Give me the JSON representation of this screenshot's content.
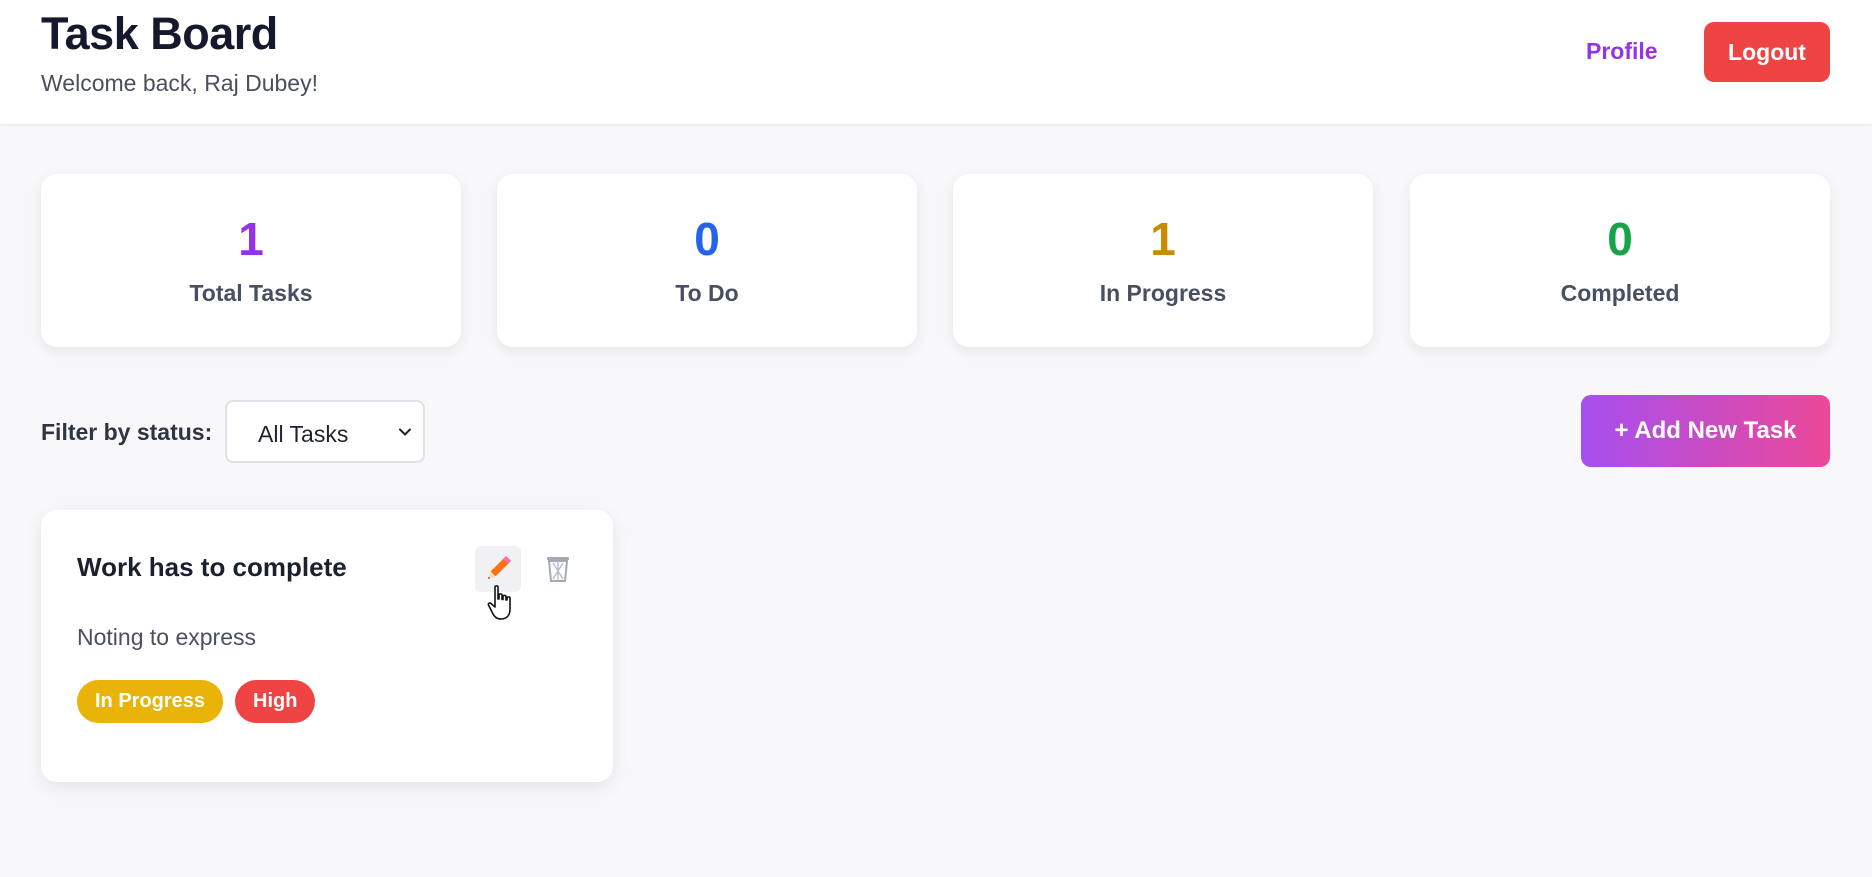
{
  "header": {
    "title": "Task Board",
    "welcome": "Welcome back, Raj Dubey!",
    "profile_label": "Profile",
    "logout_label": "Logout"
  },
  "stats": [
    {
      "value": "1",
      "label": "Total Tasks",
      "color": "#9333ea"
    },
    {
      "value": "0",
      "label": "To Do",
      "color": "#2563eb"
    },
    {
      "value": "1",
      "label": "In Progress",
      "color": "#ca8a04"
    },
    {
      "value": "0",
      "label": "Completed",
      "color": "#16a34a"
    }
  ],
  "filter": {
    "label": "Filter by status:",
    "selected": "All Tasks"
  },
  "add_task_label": "+ Add New Task",
  "tasks": [
    {
      "title": "Work has to complete",
      "description": "Noting to express",
      "status": "In Progress",
      "priority": "High",
      "edit_icon": "pencil-icon",
      "delete_icon": "trash-icon"
    }
  ],
  "colors": {
    "accent": "#9333ea",
    "danger": "#ef4444",
    "status_in_progress": "#eab308",
    "priority_high": "#ef4444"
  }
}
